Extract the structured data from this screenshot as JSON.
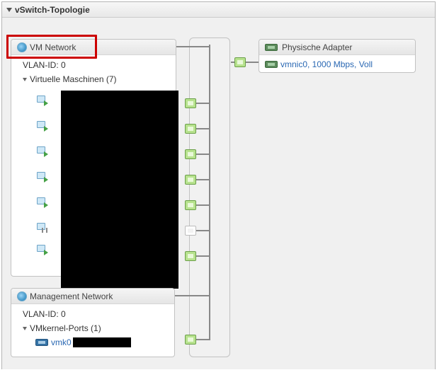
{
  "panel": {
    "title": "vSwitch-Topologie"
  },
  "vm_network": {
    "title": "VM Network",
    "vlan_label": "VLAN-ID: 0",
    "vms_label": "Virtuelle Maschinen (7)",
    "items": [
      {
        "state": "on"
      },
      {
        "state": "on"
      },
      {
        "state": "on"
      },
      {
        "state": "on"
      },
      {
        "state": "on"
      },
      {
        "state": "sus"
      },
      {
        "state": "on"
      }
    ]
  },
  "mgmt_network": {
    "title": "Management Network",
    "vlan_label": "VLAN-ID: 0",
    "ports_label": "VMkernel-Ports (1)",
    "vmk_label": "vmk0"
  },
  "physical": {
    "title": "Physische Adapter",
    "adapter_text": "vmnic0, 1000 Mbps, Voll"
  }
}
